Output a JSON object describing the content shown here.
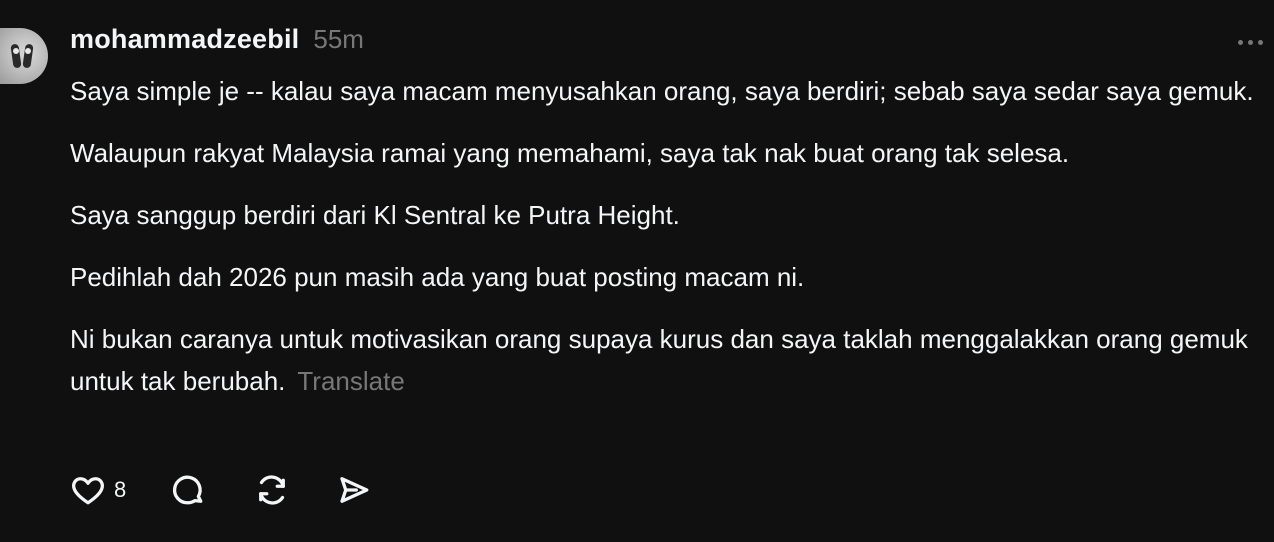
{
  "post": {
    "username": "mohammadzeebil",
    "time": "55m",
    "paragraphs": [
      "Saya simple je -- kalau saya macam menyusahkan orang, saya berdiri; sebab saya sedar saya gemuk.",
      "Walaupun rakyat Malaysia ramai yang memahami, saya tak nak buat orang tak selesa.",
      "Saya sanggup berdiri dari Kl Sentral ke Putra Height.",
      "Pedihlah dah 2026 pun masih ada yang buat posting macam ni.",
      "Ni bukan caranya untuk motivasikan orang supaya kurus dan saya taklah menggalakkan orang gemuk untuk tak berubah."
    ],
    "translate_label": "Translate"
  },
  "actions": {
    "like_icon": "heart-icon",
    "like_count": "8",
    "reply_icon": "comment-bubble-icon",
    "repost_icon": "repost-icon",
    "share_icon": "send-icon"
  },
  "menu": {
    "icon": "more-horizontal-icon"
  }
}
